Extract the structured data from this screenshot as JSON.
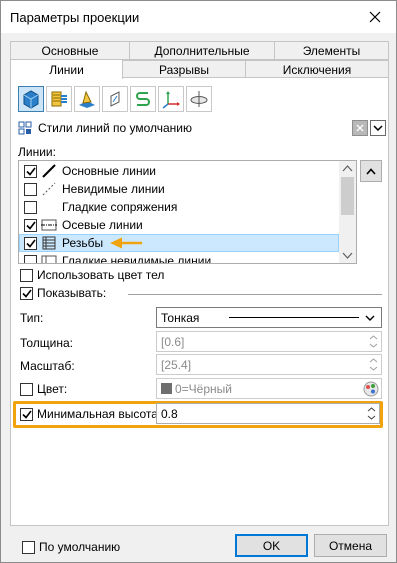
{
  "window": {
    "title": "Параметры проекции",
    "close_icon": "close-icon"
  },
  "tabs_row1": [
    {
      "label": "Основные"
    },
    {
      "label": "Дополнительные"
    },
    {
      "label": "Элементы"
    }
  ],
  "tabs_row2": [
    {
      "label": "Линии",
      "active": true
    },
    {
      "label": "Разрывы"
    },
    {
      "label": "Исключения"
    }
  ],
  "toolbar": {
    "icons": [
      "cube-icon",
      "hatch-icon",
      "section-icon",
      "plane-icon",
      "curve-icon",
      "axes-icon",
      "ellipse-icon"
    ],
    "selected_index": 0
  },
  "line_style": {
    "selected": "Стили линий по умолчанию",
    "icon": "style-grid-icon"
  },
  "lines_label": "Линии:",
  "line_items": [
    {
      "label": "Основные линии",
      "checked": true,
      "icon": "thick-line-icon"
    },
    {
      "label": "Невидимые линии",
      "checked": false,
      "icon": "dashed-line-icon"
    },
    {
      "label": "Гладкие сопряжения",
      "checked": false,
      "icon": ""
    },
    {
      "label": "Осевые линии",
      "checked": true,
      "icon": "centerline-icon"
    },
    {
      "label": "Резьбы",
      "checked": true,
      "icon": "thread-icon",
      "selected": true
    },
    {
      "label": "Гладкие невидимые линии",
      "checked": false,
      "icon": "hidden-smooth-icon"
    }
  ],
  "use_body_color": {
    "label": "Использовать цвет тел",
    "checked": false
  },
  "show": {
    "label": "Показывать:",
    "checked": true
  },
  "type": {
    "label": "Тип:",
    "value": "Тонкая"
  },
  "thickness": {
    "label": "Толщина:",
    "value": "[0.6]"
  },
  "scale": {
    "label": "Масштаб:",
    "value": "[25.4]"
  },
  "color": {
    "label": "Цвет:",
    "checked": false,
    "value": "0=Чёрный",
    "swatch": "#6e6e6e"
  },
  "min_height": {
    "label": "Минимальная высота:",
    "checked": true,
    "value": "0.8"
  },
  "footer": {
    "default_label": "По умолчанию",
    "default_checked": false,
    "ok_label": "OK",
    "cancel_label": "Отмена"
  },
  "accent_color": "#f0a30a"
}
